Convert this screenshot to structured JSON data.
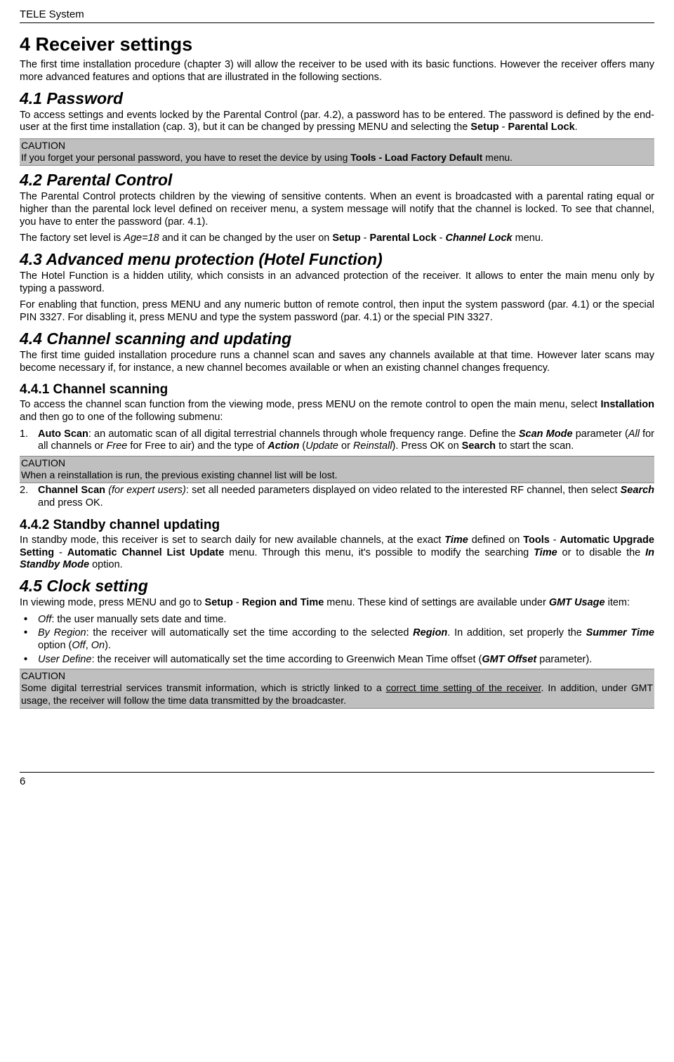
{
  "header": "TELE System",
  "page_number": "6",
  "s4": {
    "title": "4  Receiver settings",
    "intro": "The first time installation procedure (chapter 3) will allow the receiver to be used with its basic functions. However the receiver offers many more advanced features and options that are illustrated in the following sections."
  },
  "s41": {
    "title": "4.1 Password",
    "caution": "If you forget your personal password, you have to reset the device by using Tools - Load Factory Default menu."
  },
  "s42": {
    "title": "4.2 Parental Control"
  },
  "s43": {
    "title": "4.3 Advanced menu protection (Hotel Function)"
  },
  "s44": {
    "title": "4.4 Channel scanning and updating",
    "intro": "The first time guided installation procedure runs a channel scan and saves any channels available at that time. However later scans may become necessary if, for instance, a new channel becomes available or when an existing channel changes frequency."
  },
  "s441": {
    "title": "4.4.1  Channel scanning",
    "caution": "When a reinstallation is run, the previous existing channel list will be lost."
  },
  "s442": {
    "title": "4.4.2  Standby channel updating"
  },
  "s45": {
    "title": "4.5 Clock setting"
  },
  "caution_label": "CAUTION"
}
